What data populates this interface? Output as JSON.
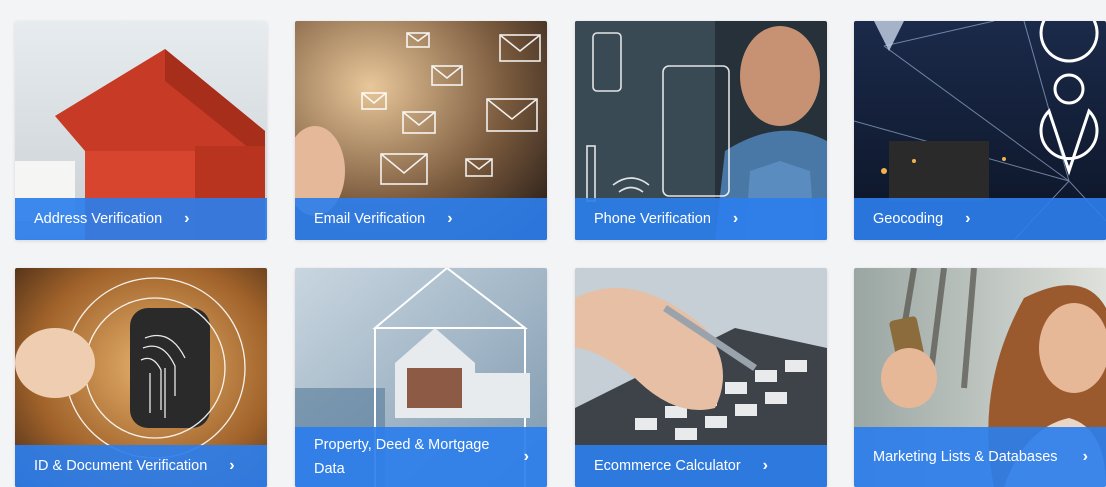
{
  "cards": [
    {
      "label": "Address Verification",
      "chevron": "›",
      "icon": "house-photo"
    },
    {
      "label": "Email Verification",
      "chevron": "›",
      "icon": "envelopes-photo"
    },
    {
      "label": "Phone Verification",
      "chevron": "›",
      "icon": "phone-man-photo"
    },
    {
      "label": "Geocoding",
      "chevron": "›",
      "icon": "map-pin-city-photo"
    },
    {
      "label": "ID & Document Verification",
      "chevron": "›",
      "icon": "fingerprint-photo"
    },
    {
      "label": "Property, Deed & Mortgage Data",
      "chevron": "›",
      "icon": "property-house-photo"
    },
    {
      "label": "Ecommerce Calculator",
      "chevron": "›",
      "icon": "calculator-photo"
    },
    {
      "label": "Marketing Lists & Databases",
      "chevron": "›",
      "icon": "woman-phone-photo"
    }
  ],
  "colors": {
    "caption_bg": "#2d7eec",
    "caption_text": "#ffffff",
    "page_bg": "#f3f4f6"
  }
}
